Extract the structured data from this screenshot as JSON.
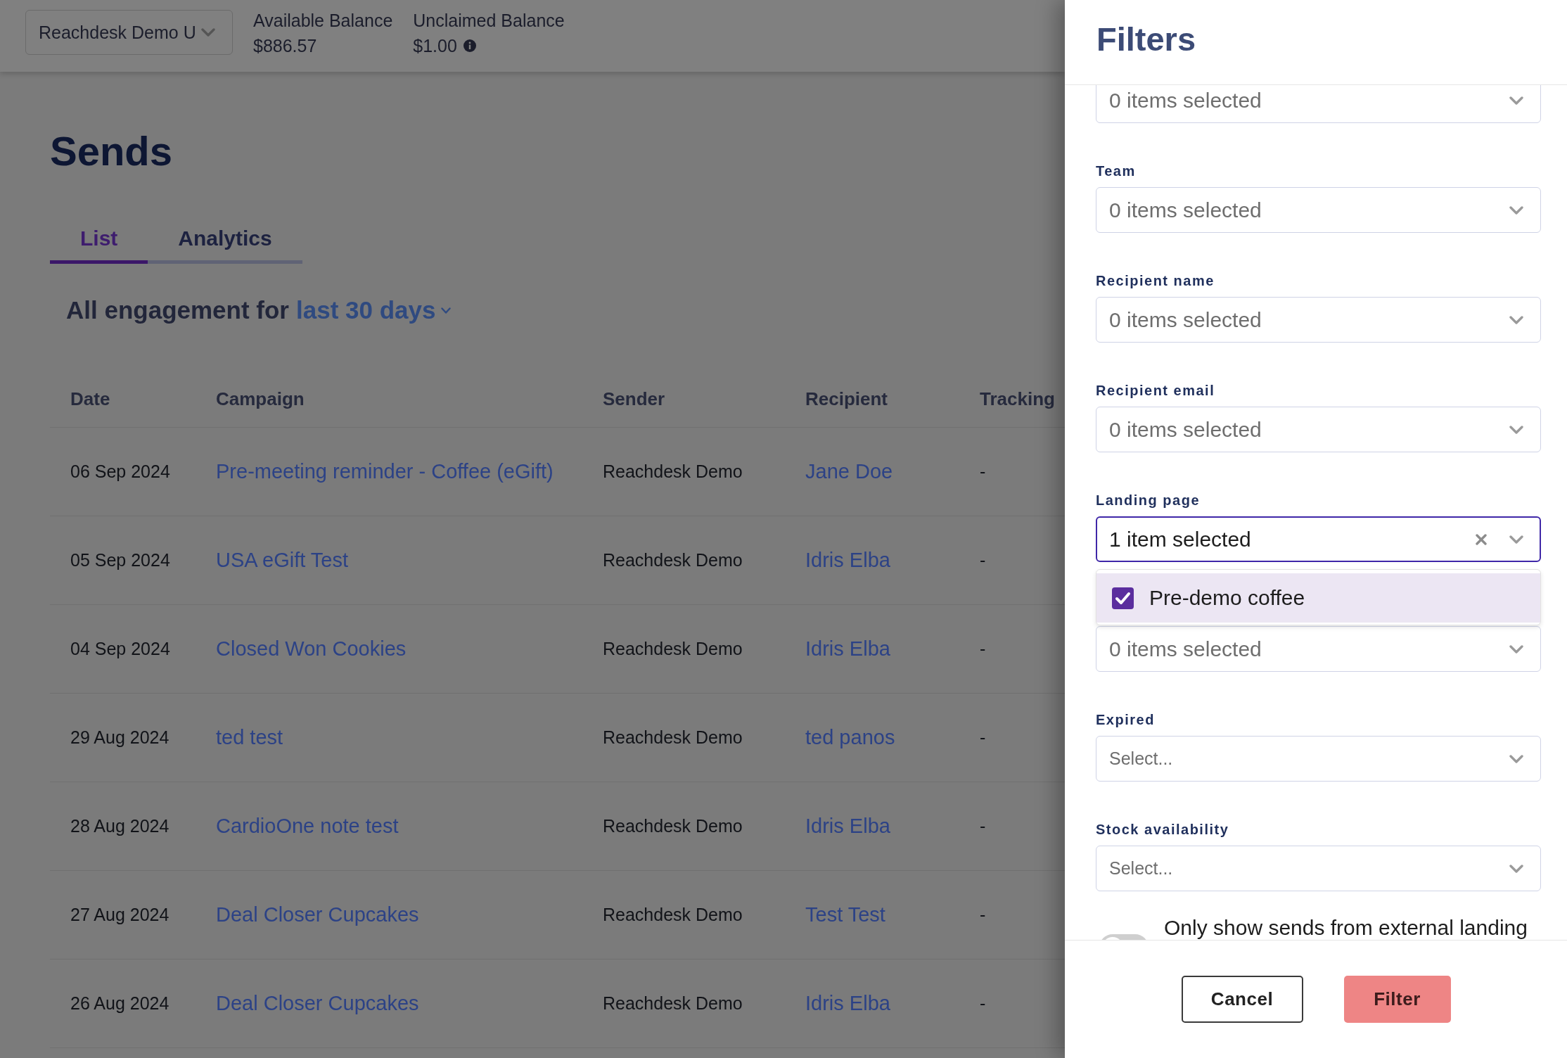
{
  "top_bar": {
    "account_selector": {
      "value": "Reachdesk Demo U"
    },
    "balances": [
      {
        "label": "Available Balance",
        "value": "$886.57",
        "info": false
      },
      {
        "label": "Unclaimed Balance",
        "value": "$1.00",
        "info": true
      }
    ]
  },
  "page": {
    "title": "Sends",
    "tabs": [
      {
        "label": "List",
        "selected": true
      },
      {
        "label": "Analytics",
        "selected": false
      }
    ],
    "engagement": {
      "label": "All engagement for",
      "period": "last 30 days"
    },
    "table": {
      "columns": [
        {
          "label": "Date",
          "kind": "text"
        },
        {
          "label": "Campaign",
          "kind": "link"
        },
        {
          "label": "Sender",
          "kind": "text"
        },
        {
          "label": "Recipient",
          "kind": "link"
        },
        {
          "label": "Tracking",
          "kind": "text"
        }
      ],
      "rows": [
        [
          "06 Sep 2024",
          "Pre-meeting reminder - Coffee (eGift)",
          "Reachdesk Demo",
          "Jane Doe",
          "-"
        ],
        [
          "05 Sep 2024",
          "USA eGift Test",
          "Reachdesk Demo",
          "Idris Elba",
          "-"
        ],
        [
          "04 Sep 2024",
          "Closed Won Cookies",
          "Reachdesk Demo",
          "Idris Elba",
          "-"
        ],
        [
          "29 Aug 2024",
          "ted test",
          "Reachdesk Demo",
          "ted panos",
          "-"
        ],
        [
          "28 Aug 2024",
          "CardioOne note test",
          "Reachdesk Demo",
          "Idris Elba",
          "-"
        ],
        [
          "27 Aug 2024",
          "Deal Closer Cupcakes",
          "Reachdesk Demo",
          "Test Test",
          "-"
        ],
        [
          "26 Aug 2024",
          "Deal Closer Cupcakes",
          "Reachdesk Demo",
          "Idris Elba",
          "-"
        ]
      ]
    }
  },
  "filters": {
    "title": "Filters",
    "fields": [
      {
        "kind": "multi",
        "placeholder": "0 items selected",
        "focused": false
      },
      {
        "kind": "multi",
        "label": "Team",
        "placeholder": "0 items selected",
        "focused": false
      },
      {
        "kind": "multi",
        "label": "Recipient name",
        "placeholder": "0 items selected",
        "focused": false
      },
      {
        "kind": "multi",
        "label": "Recipient email",
        "placeholder": "0 items selected",
        "focused": false
      },
      {
        "kind": "multi",
        "label": "Landing page",
        "value": "1 item selected",
        "focused": true,
        "options": [
          {
            "label": "Pre-demo coffee",
            "checked": true
          }
        ]
      },
      {
        "kind": "multi",
        "placeholder": "0 items selected",
        "focused": false
      },
      {
        "kind": "single",
        "label": "Expired",
        "placeholder": "Select...",
        "focused": false
      },
      {
        "kind": "single",
        "label": "Stock availability",
        "placeholder": "Select...",
        "focused": false
      }
    ],
    "toggle": {
      "label": "Only show sends from external landing",
      "on": false
    },
    "buttons": [
      {
        "label": "Cancel",
        "kind": "secondary"
      },
      {
        "label": "Filter",
        "kind": "primary"
      }
    ]
  }
}
